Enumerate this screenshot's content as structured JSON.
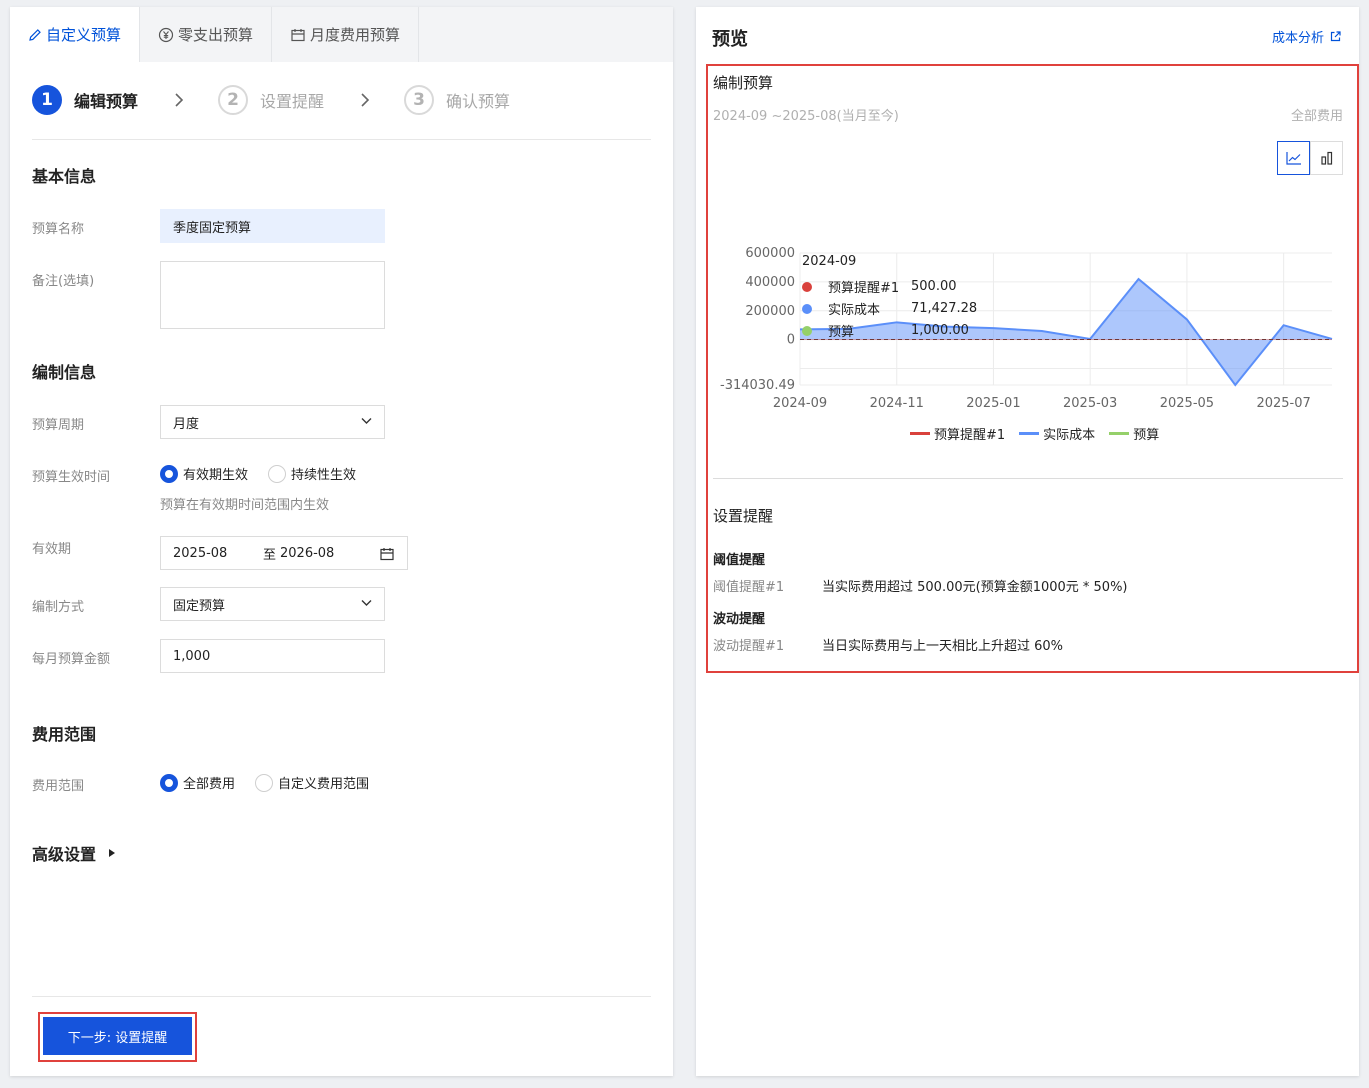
{
  "tabs": [
    {
      "label": "自定义预算",
      "icon": "pencil-icon"
    },
    {
      "label": "零支出预算",
      "icon": "yen-circle-icon"
    },
    {
      "label": "月度费用预算",
      "icon": "calendar-icon"
    }
  ],
  "steps": [
    {
      "num": "1",
      "label": "编辑预算"
    },
    {
      "num": "2",
      "label": "设置提醒"
    },
    {
      "num": "3",
      "label": "确认预算"
    }
  ],
  "basic": {
    "title": "基本信息",
    "name_label": "预算名称",
    "name_value": "季度固定预算",
    "note_label": "备注(选填)",
    "note_value": ""
  },
  "compile": {
    "title": "编制信息",
    "period_label": "预算周期",
    "period_value": "月度",
    "effect_label": "预算生效时间",
    "effect_options": [
      "有效期生效",
      "持续性生效"
    ],
    "effect_hint": "预算在有效期时间范围内生效",
    "valid_label": "有效期",
    "valid_start": "2025-08",
    "valid_sep": "至",
    "valid_end": "2026-08",
    "method_label": "编制方式",
    "method_value": "固定预算",
    "amount_label": "每月预算金额",
    "amount_value": "1,000"
  },
  "scope": {
    "title": "费用范围",
    "label": "费用范围",
    "options": [
      "全部费用",
      "自定义费用范围"
    ]
  },
  "advanced": {
    "title": "高级设置"
  },
  "footer": {
    "next_button": "下一步: 设置提醒"
  },
  "preview": {
    "title": "预览",
    "analysis_link": "成本分析",
    "section_title": "编制预算",
    "date_range": "2024-09 ~2025-08(当月至今)",
    "scope_text": "全部费用",
    "tooltip": {
      "title": "2024-09",
      "rows": [
        {
          "name": "预算提醒#1",
          "value": "500.00",
          "color": "#d9413c"
        },
        {
          "name": "实际成本",
          "value": "71,427.28",
          "color": "#5b8ff9"
        },
        {
          "name": "预算",
          "value": "1,000.00",
          "color": "#95d06a"
        }
      ]
    },
    "alert_title": "设置提醒",
    "threshold_title": "阈值提醒",
    "threshold_name": "阈值提醒#1",
    "threshold_desc": "当实际费用超过 500.00元(预算金额1000元 * 50%)",
    "fluct_title": "波动提醒",
    "fluct_name": "波动提醒#1",
    "fluct_desc": "当日实际费用与上一天相比上升超过 60%"
  },
  "chart_data": {
    "type": "area",
    "x": [
      "2024-09",
      "2024-10",
      "2024-11",
      "2024-12",
      "2025-01",
      "2025-02",
      "2025-03",
      "2025-04",
      "2025-05",
      "2025-06",
      "2025-07",
      "2025-08"
    ],
    "x_tick_labels": [
      "2024-09",
      "2024-11",
      "2025-01",
      "2025-03",
      "2025-05",
      "2025-07"
    ],
    "y_tick_labels": [
      "600000",
      "400000",
      "200000",
      "0",
      "-314030.49"
    ],
    "ylim": [
      -314030.49,
      600000
    ],
    "series": [
      {
        "name": "预算提醒#1",
        "color": "#d9413c",
        "values": [
          500,
          500,
          500,
          500,
          500,
          500,
          500,
          500,
          500,
          500,
          500,
          500
        ]
      },
      {
        "name": "实际成本",
        "color": "#5b8ff9",
        "values": [
          71427.28,
          75000,
          120000,
          90000,
          80000,
          60000,
          5000,
          420000,
          140000,
          -314030.49,
          100000,
          5000
        ]
      },
      {
        "name": "预算",
        "color": "#95d06a",
        "values": [
          1000,
          1000,
          1000,
          1000,
          1000,
          1000,
          1000,
          1000,
          1000,
          1000,
          1000,
          1000
        ]
      }
    ],
    "grid": true,
    "legend": "bottom-center"
  },
  "colors": {
    "primary": "#1654dc",
    "highlight": "#e0413c"
  }
}
